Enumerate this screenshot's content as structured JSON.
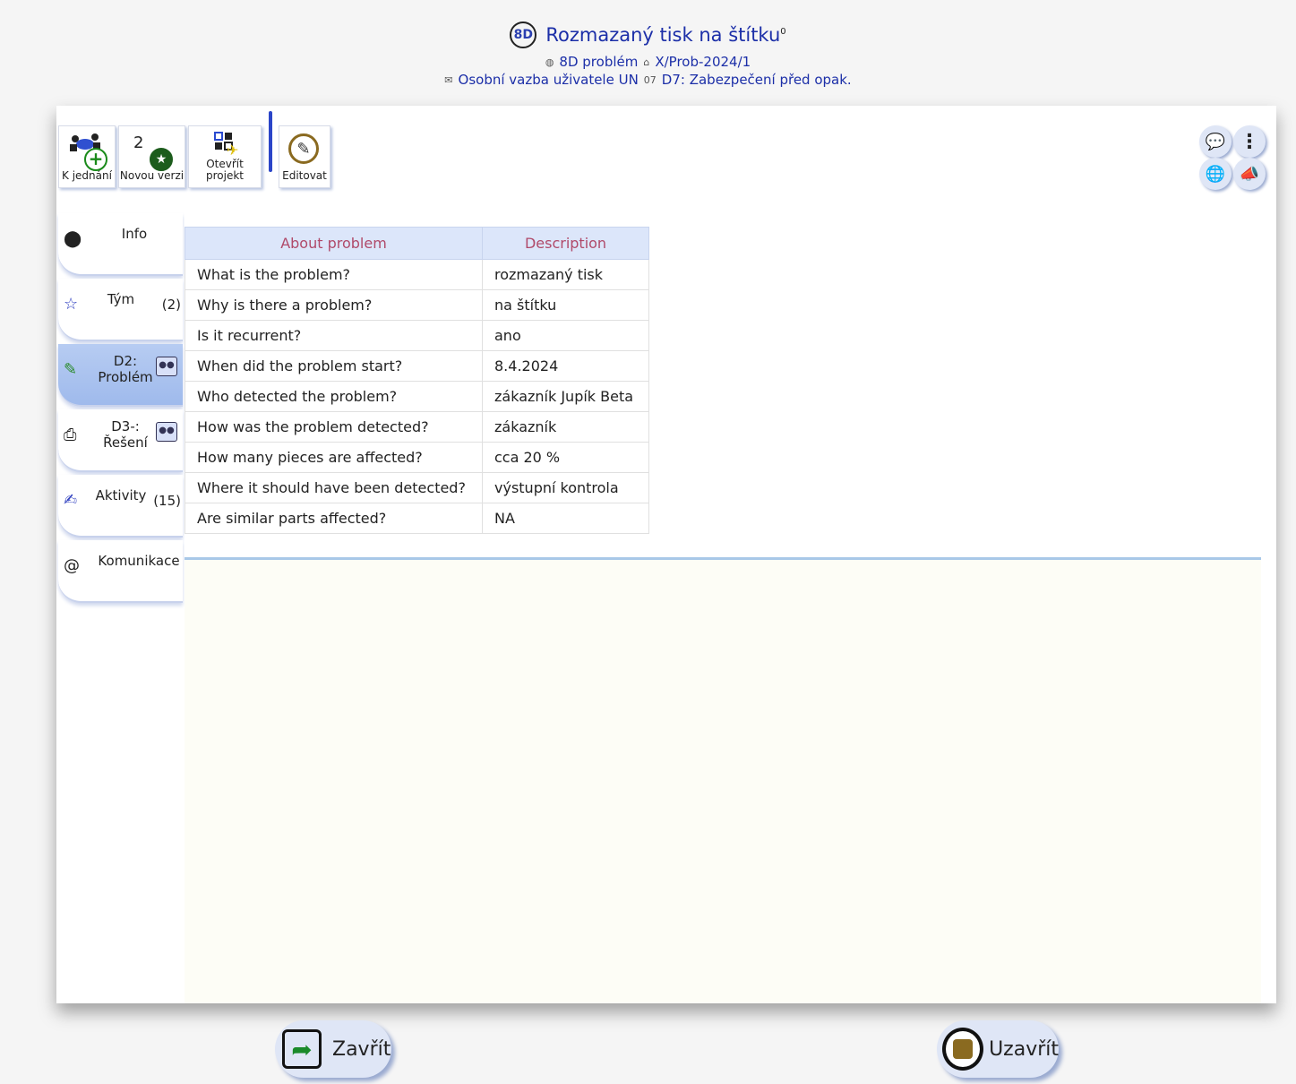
{
  "header": {
    "badge": "8D",
    "title": "Rozmazaný tisk na štítku",
    "title_sup": "0",
    "type_label": "8D problém",
    "code": "X/Prob-2024/1",
    "owner": "Osobní vazba uživatele UN",
    "step_tag": "07",
    "step": "D7: Zabezpečení před opak."
  },
  "toolbar": {
    "jednani": "K jednání",
    "verze_num": "2",
    "verze": "Novou verzi",
    "projekt": "Otevřít projekt",
    "edit": "Editovat"
  },
  "sidebar": {
    "items": [
      {
        "label": "Info",
        "count": ""
      },
      {
        "label": "Tým",
        "count": "(2)"
      },
      {
        "label": "D2: Problém",
        "count": ""
      },
      {
        "label": "D3-: Řešení",
        "count": ""
      },
      {
        "label": "Aktivity",
        "count": "(15)"
      },
      {
        "label": "Komunikace",
        "count": ""
      }
    ]
  },
  "table": {
    "headers": [
      "About problem",
      "Description"
    ],
    "rows": [
      [
        "What is the problem?",
        "rozmazaný tisk"
      ],
      [
        "Why is there a problem?",
        "na štítku"
      ],
      [
        "Is it recurrent?",
        "ano"
      ],
      [
        "When did the problem start?",
        "8.4.2024"
      ],
      [
        "Who detected the problem?",
        "zákazník Jupík Beta"
      ],
      [
        "How was the problem detected?",
        "zákazník"
      ],
      [
        "How many pieces are affected?",
        "cca 20 %"
      ],
      [
        "Where it should have been detected?",
        "výstupní kontrola"
      ],
      [
        "Are similar parts affected?",
        "NA"
      ]
    ]
  },
  "footer": {
    "zavrit": "Zavřít",
    "uzavrit": "Uzavřít"
  },
  "colors": {
    "accent": "#1c2fa8",
    "active_tab": "#a8c0ee",
    "table_header": "#dce6fa",
    "header_text": "#b04a6a"
  }
}
